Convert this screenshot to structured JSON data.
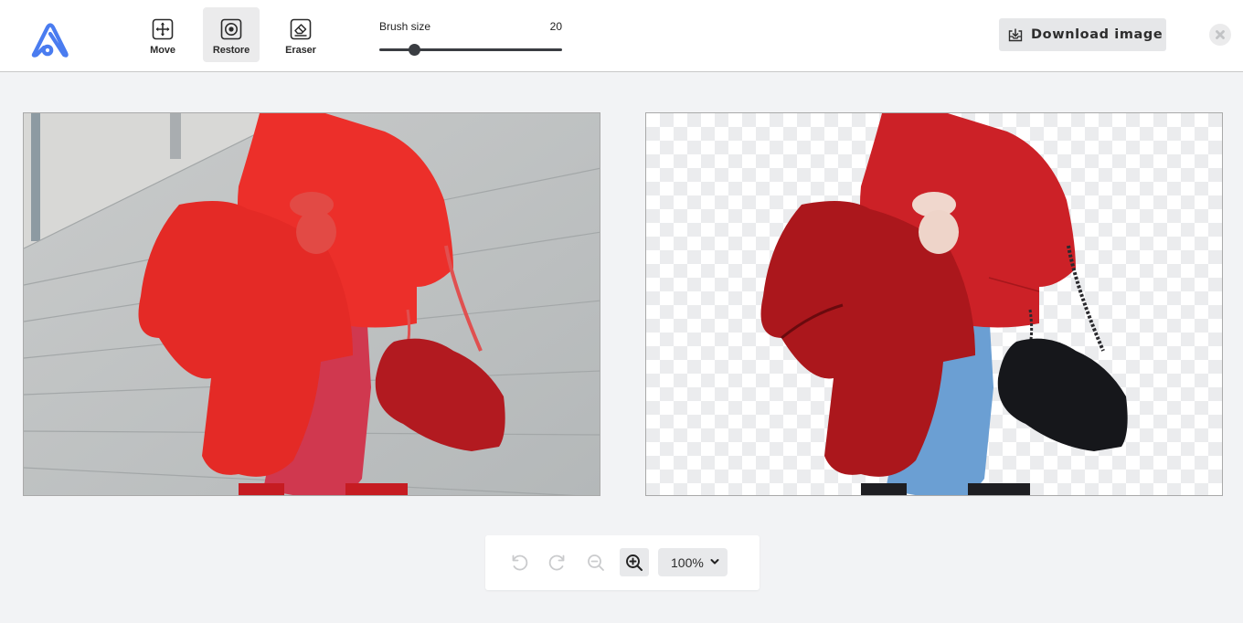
{
  "app": {
    "logo": "app-logo-icon",
    "brand_color": "#4a7cf0"
  },
  "toolbar": {
    "tools": [
      {
        "id": "move",
        "label": "Move",
        "icon": "move-arrows-icon",
        "active": false
      },
      {
        "id": "restore",
        "label": "Restore",
        "icon": "restore-target-icon",
        "active": true
      },
      {
        "id": "eraser",
        "label": "Eraser",
        "icon": "eraser-icon",
        "active": false
      }
    ],
    "brush_size": {
      "label": "Brush size",
      "value": "20",
      "min": 1,
      "max": 100,
      "current": 20
    },
    "download_label": "Download image",
    "download_icon": "download-tray-icon",
    "close_icon": "close-x-icon"
  },
  "canvas": {
    "left_panel": {
      "name": "original-with-mask",
      "description": "Original photo with red selection overlay"
    },
    "right_panel": {
      "name": "result-preview",
      "description": "Background removed result on transparency checkerboard"
    },
    "colors": {
      "overlay_red": "#e8312c",
      "sweater_red": "#c81f24",
      "coat_red": "#a8161b",
      "jeans_blue": "#6b9fd3",
      "bag_black": "#15161a",
      "wall_gray": "#b9bcbd",
      "checker_gray": "#ebecee"
    }
  },
  "bottom_bar": {
    "undo_icon": "undo-icon",
    "redo_icon": "redo-icon",
    "zoom_out_icon": "zoom-out-icon",
    "zoom_in_icon": "zoom-in-icon",
    "zoom_level": "100%"
  }
}
